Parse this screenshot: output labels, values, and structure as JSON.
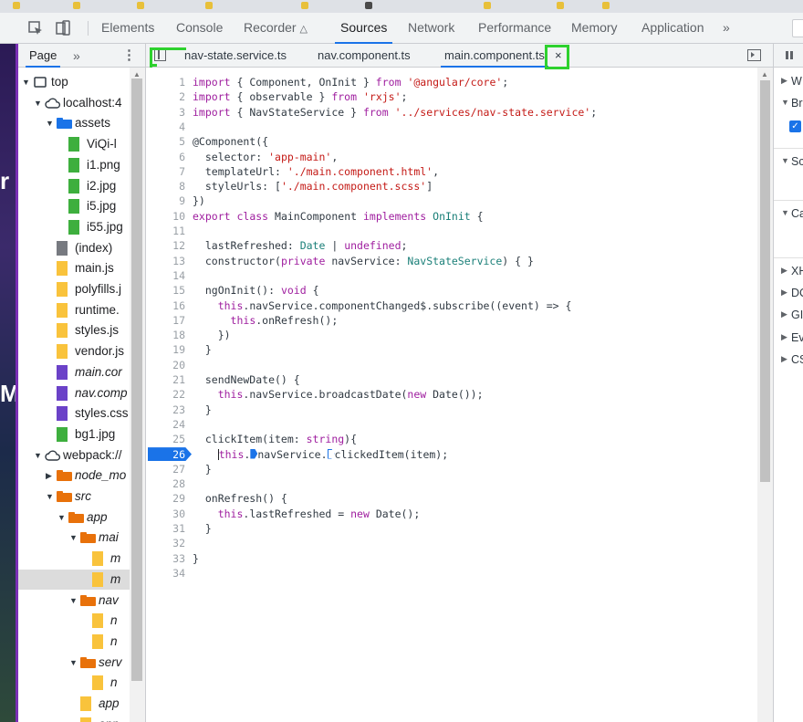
{
  "devtools_tabs": [
    "Elements",
    "Console",
    "Recorder",
    "Sources",
    "Network",
    "Performance",
    "Memory",
    "Application"
  ],
  "devtools_active_tab": "Sources",
  "navigator": {
    "tab_label": "Page",
    "tree": [
      {
        "label": "top",
        "icon": "frame-icon",
        "level": 0,
        "expanded": true
      },
      {
        "label": "localhost:4",
        "icon": "cloud-icon",
        "level": 1,
        "expanded": true
      },
      {
        "label": "assets",
        "icon": "folder-icon",
        "color": "#1a73e8",
        "level": 2,
        "expanded": true
      },
      {
        "label": "ViQi-l",
        "icon": "file-icon",
        "color": "#3eaf3e",
        "level": 3
      },
      {
        "label": "i1.png",
        "icon": "file-icon",
        "color": "#3eaf3e",
        "level": 3
      },
      {
        "label": "i2.jpg",
        "icon": "file-icon",
        "color": "#3eaf3e",
        "level": 3
      },
      {
        "label": "i5.jpg",
        "icon": "file-icon",
        "color": "#3eaf3e",
        "level": 3
      },
      {
        "label": "i55.jpg",
        "icon": "file-icon",
        "color": "#3eaf3e",
        "level": 3
      },
      {
        "label": "(index)",
        "icon": "file-icon",
        "color": "#777a80",
        "level": 2
      },
      {
        "label": "main.js",
        "icon": "file-icon",
        "color": "#f9c33c",
        "level": 2
      },
      {
        "label": "polyfills.j",
        "icon": "file-icon",
        "color": "#f9c33c",
        "level": 2
      },
      {
        "label": "runtime.",
        "icon": "file-icon",
        "color": "#f9c33c",
        "level": 2
      },
      {
        "label": "styles.js",
        "icon": "file-icon",
        "color": "#f9c33c",
        "level": 2
      },
      {
        "label": "vendor.js",
        "icon": "file-icon",
        "color": "#f9c33c",
        "level": 2
      },
      {
        "label": "main.cor",
        "icon": "file-icon",
        "color": "#6b42c8",
        "level": 2,
        "italic": true
      },
      {
        "label": "nav.comp",
        "icon": "file-icon",
        "color": "#6b42c8",
        "level": 2,
        "italic": true
      },
      {
        "label": "styles.css",
        "icon": "file-icon",
        "color": "#6b42c8",
        "level": 2
      },
      {
        "label": "bg1.jpg",
        "icon": "file-icon",
        "color": "#3eaf3e",
        "level": 2
      },
      {
        "label": "webpack://",
        "icon": "cloud-icon",
        "level": 1,
        "expanded": true
      },
      {
        "label": "node_mo",
        "icon": "folder-icon",
        "color": "#e8710a",
        "level": 2,
        "expanded": false,
        "italic": true
      },
      {
        "label": "src",
        "icon": "folder-icon",
        "color": "#e8710a",
        "level": 2,
        "expanded": true,
        "italic": true
      },
      {
        "label": "app",
        "icon": "folder-icon",
        "color": "#e8710a",
        "level": 3,
        "expanded": true,
        "italic": true
      },
      {
        "label": "mai",
        "icon": "folder-icon",
        "color": "#e8710a",
        "level": 4,
        "expanded": true,
        "italic": true
      },
      {
        "label": "m",
        "icon": "file-icon",
        "color": "#f9c33c",
        "level": 5,
        "italic": true
      },
      {
        "label": "m",
        "icon": "file-icon",
        "color": "#f9c33c",
        "level": 5,
        "italic": true,
        "selected": true
      },
      {
        "label": "nav",
        "icon": "folder-icon",
        "color": "#e8710a",
        "level": 4,
        "expanded": true,
        "italic": true
      },
      {
        "label": "n",
        "icon": "file-icon",
        "color": "#f9c33c",
        "level": 5,
        "italic": true
      },
      {
        "label": "n",
        "icon": "file-icon",
        "color": "#f9c33c",
        "level": 5,
        "italic": true
      },
      {
        "label": "serv",
        "icon": "folder-icon",
        "color": "#e8710a",
        "level": 4,
        "expanded": true,
        "italic": true
      },
      {
        "label": "n",
        "icon": "file-icon",
        "color": "#f9c33c",
        "level": 5,
        "italic": true
      },
      {
        "label": "app",
        "icon": "file-icon",
        "color": "#f9c33c",
        "level": 4,
        "italic": true
      },
      {
        "label": "app",
        "icon": "file-icon",
        "color": "#f9c33c",
        "level": 4,
        "italic": true
      }
    ]
  },
  "editor": {
    "tabs": [
      "nav-state.service.ts",
      "nav.component.ts",
      "main.component.ts"
    ],
    "active_tab": "main.component.ts",
    "close_glyph": "×",
    "breakpoint_line": 26,
    "lines": [
      [
        [
          "kw",
          "import"
        ],
        [
          "p",
          " { Component, OnInit } "
        ],
        [
          "kw",
          "from"
        ],
        [
          "p",
          " "
        ],
        [
          "st",
          "'@angular/core'"
        ],
        [
          "p",
          ";"
        ]
      ],
      [
        [
          "kw",
          "import"
        ],
        [
          "p",
          " { observable } "
        ],
        [
          "kw",
          "from"
        ],
        [
          "p",
          " "
        ],
        [
          "st",
          "'rxjs'"
        ],
        [
          "p",
          ";"
        ]
      ],
      [
        [
          "kw",
          "import"
        ],
        [
          "p",
          " { NavStateService } "
        ],
        [
          "kw",
          "from"
        ],
        [
          "p",
          " "
        ],
        [
          "st",
          "'../services/nav-state.service'"
        ],
        [
          "p",
          ";"
        ]
      ],
      [],
      [
        [
          "p",
          "@Component({"
        ]
      ],
      [
        [
          "p",
          "  selector: "
        ],
        [
          "st",
          "'app-main'"
        ],
        [
          "p",
          ","
        ]
      ],
      [
        [
          "p",
          "  templateUrl: "
        ],
        [
          "st",
          "'./main.component.html'"
        ],
        [
          "p",
          ","
        ]
      ],
      [
        [
          "p",
          "  styleUrls: ["
        ],
        [
          "st",
          "'./main.component.scss'"
        ],
        [
          "p",
          "]"
        ]
      ],
      [
        [
          "p",
          "})"
        ]
      ],
      [
        [
          "kw",
          "export"
        ],
        [
          "p",
          " "
        ],
        [
          "kw",
          "class"
        ],
        [
          "p",
          " MainComponent "
        ],
        [
          "kw",
          "implements"
        ],
        [
          "p",
          " "
        ],
        [
          "ty",
          "OnInit"
        ],
        [
          "p",
          " {"
        ]
      ],
      [],
      [
        [
          "p",
          "  lastRefreshed: "
        ],
        [
          "ty",
          "Date"
        ],
        [
          "p",
          " | "
        ],
        [
          "kw",
          "undefined"
        ],
        [
          "p",
          ";"
        ]
      ],
      [
        [
          "p",
          "  constructor("
        ],
        [
          "kw",
          "private"
        ],
        [
          "p",
          " navService: "
        ],
        [
          "ty",
          "NavStateService"
        ],
        [
          "p",
          ") { }"
        ]
      ],
      [],
      [
        [
          "p",
          "  ngOnInit(): "
        ],
        [
          "kw",
          "void"
        ],
        [
          "p",
          " {"
        ]
      ],
      [
        [
          "p",
          "    "
        ],
        [
          "kw",
          "this"
        ],
        [
          "p",
          ".navService.componentChanged$.subscribe((event) => {"
        ]
      ],
      [
        [
          "p",
          "      "
        ],
        [
          "kw",
          "this"
        ],
        [
          "p",
          ".onRefresh();"
        ]
      ],
      [
        [
          "p",
          "    })"
        ]
      ],
      [
        [
          "p",
          "  }"
        ]
      ],
      [],
      [
        [
          "p",
          "  sendNewDate() {"
        ]
      ],
      [
        [
          "p",
          "    "
        ],
        [
          "kw",
          "this"
        ],
        [
          "p",
          ".navService.broadcastDate("
        ],
        [
          "kw",
          "new"
        ],
        [
          "p",
          " Date());"
        ]
      ],
      [
        [
          "p",
          "  }"
        ]
      ],
      [],
      [
        [
          "p",
          "  clickItem(item: "
        ],
        [
          "kw",
          "string"
        ],
        [
          "p",
          "){"
        ]
      ],
      [
        [
          "p",
          "    "
        ],
        [
          "caret",
          ""
        ],
        [
          "kw",
          "this"
        ],
        [
          "p",
          "."
        ],
        [
          "bp",
          ""
        ],
        [
          "p",
          "navService."
        ],
        [
          "bph",
          ""
        ],
        [
          "p",
          "clickedItem(item);"
        ]
      ],
      [
        [
          "p",
          "  }"
        ]
      ],
      [],
      [
        [
          "p",
          "  onRefresh() {"
        ]
      ],
      [
        [
          "p",
          "    "
        ],
        [
          "kw",
          "this"
        ],
        [
          "p",
          ".lastRefreshed = "
        ],
        [
          "kw",
          "new"
        ],
        [
          "p",
          " Date();"
        ]
      ],
      [
        [
          "p",
          "  }"
        ]
      ],
      [],
      [
        [
          "p",
          "}"
        ]
      ],
      []
    ]
  },
  "debugger": {
    "sections": [
      {
        "label": "W",
        "collapsed": true
      },
      {
        "label": "Br",
        "collapsed": false,
        "checkbox": "✓"
      },
      {
        "label": "Sc",
        "collapsed": false
      },
      {
        "label": "Ca",
        "collapsed": false
      },
      {
        "label": "XH",
        "collapsed": true
      },
      {
        "label": "DC",
        "collapsed": true
      },
      {
        "label": "GI",
        "collapsed": true
      },
      {
        "label": "Ev",
        "collapsed": true
      },
      {
        "label": "CS",
        "collapsed": true
      }
    ]
  },
  "page_strip_glyphs": [
    "r",
    "M"
  ],
  "colors": {
    "accent": "#1a73e8",
    "annotation_highlight": "#2ed12e"
  }
}
